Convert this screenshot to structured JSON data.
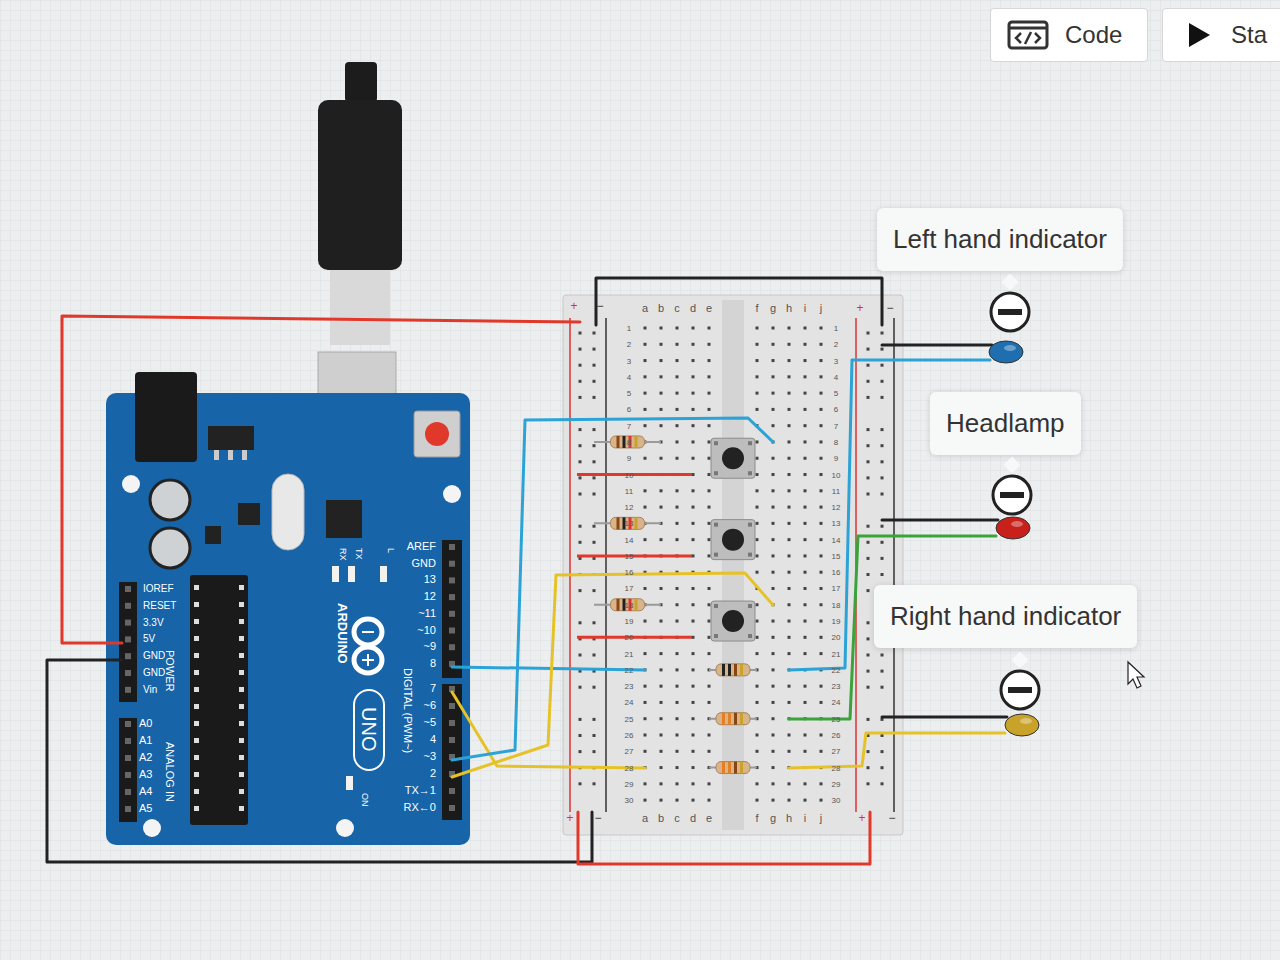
{
  "toolbar": {
    "buttons": [
      {
        "label": "Code",
        "kind": "code"
      },
      {
        "label": "Sta",
        "kind": "start"
      }
    ]
  },
  "indicators": [
    {
      "label": "Left hand indicator",
      "color": "#1f6fb0"
    },
    {
      "label": "Headlamp",
      "color": "#c8211c"
    },
    {
      "label": "Right hand indicator",
      "color": "#c9a229"
    }
  ],
  "arduino": {
    "brand": "ARDUINO",
    "model": "UNO",
    "digital_header": "DIGITAL (PWM~)",
    "digital_pins": [
      "AREF",
      "GND",
      "13",
      "12",
      "~11",
      "~10",
      "~9",
      "8",
      "7",
      "~6",
      "~5",
      "4",
      "~3",
      "2",
      "TX→1",
      "RX←0"
    ],
    "power_header": "POWER",
    "power_pins": [
      "IOREF",
      "RESET",
      "3.3V",
      "5V",
      "GND",
      "GND",
      "Vin"
    ],
    "analog_header": "ANALOG IN",
    "analog_pins": [
      "A0",
      "A1",
      "A2",
      "A3",
      "A4",
      "A5"
    ],
    "board_leds": [
      "RX",
      "TX",
      "L"
    ],
    "power_led": "ON"
  },
  "breadboard": {
    "columns_left": [
      "a",
      "b",
      "c",
      "d",
      "e"
    ],
    "columns_right": [
      "f",
      "g",
      "h",
      "i",
      "j"
    ],
    "rows": [
      "1",
      "2",
      "3",
      "4",
      "5",
      "6",
      "7",
      "8",
      "9",
      "10",
      "11",
      "12",
      "13",
      "14",
      "15",
      "16",
      "17",
      "18",
      "19",
      "20",
      "21",
      "22",
      "23",
      "24",
      "25",
      "26",
      "27",
      "28",
      "29",
      "30"
    ],
    "rail_plus": "+",
    "rail_minus": "−"
  }
}
